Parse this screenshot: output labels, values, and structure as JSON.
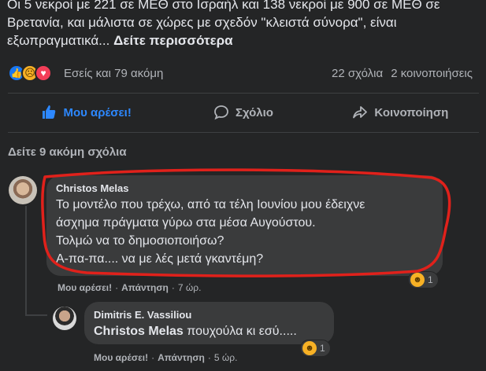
{
  "post": {
    "text": "Οι 5 νεκροί με 221 σε ΜΕΘ στο Ισραήλ και 138 νεκροί με 900 σε ΜΕΘ σε Βρετανία, και μάλιστα σε χώρες με σχεδόν \"κλειστά σύνορα\", είναι εξωπραγματικά...",
    "see_more": "Δείτε περισσότερα"
  },
  "reactions": {
    "summary": "Εσείς και 79 ακόμη",
    "comments": "22 σχόλια",
    "shares": "2 κοινοποιήσεις",
    "icons": [
      "like-icon",
      "sad-icon",
      "love-icon"
    ]
  },
  "actions": {
    "like": "Μου αρέσει!",
    "comment": "Σχόλιο",
    "share": "Κοινοποίηση"
  },
  "colors": {
    "background": "#242526",
    "bubble": "#3a3b3c",
    "accent": "#2d88ff",
    "annotation": "#e0211b"
  },
  "more_comments": "Δείτε 9 ακόμη σχόλια",
  "comments": [
    {
      "author": "Christos Melas",
      "lines": [
        "Το μοντέλο που τρέχω, από τα τέλη Ιουνίου μου έδειχνε",
        "άσχημα πράγματα γύρω στα μέσα Αυγούστου.",
        "Τολμώ να το δημοσιοποιήσω?",
        "Α-πα-πα.... να με λές μετά γκαντέμη?"
      ],
      "like": "Μου αρέσει!",
      "reply": "Απάντηση",
      "sep": "·",
      "time": "7 ώρ.",
      "reaction_count": "1"
    },
    {
      "author": "Dimitris E. Vassiliou",
      "mention": "Christos Melas",
      "text": " πουχούλα κι εσύ.....",
      "like": "Μου αρέσει!",
      "reply": "Απάντηση",
      "sep": "·",
      "time": "5 ώρ.",
      "reaction_count": "1"
    }
  ]
}
